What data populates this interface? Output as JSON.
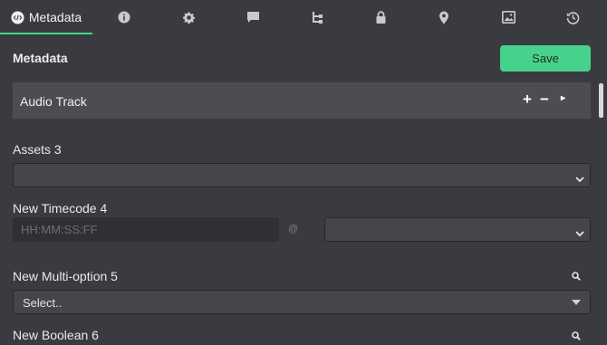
{
  "tabs": [
    {
      "label": "Metadata",
      "icon": "code-icon"
    },
    {
      "icon": "info-icon"
    },
    {
      "icon": "gear-icon"
    },
    {
      "icon": "comment-icon"
    },
    {
      "icon": "tree-icon"
    },
    {
      "icon": "lock-icon"
    },
    {
      "icon": "map-pin-icon"
    },
    {
      "icon": "image-icon"
    },
    {
      "icon": "history-icon"
    }
  ],
  "header": {
    "title": "Metadata",
    "save_label": "Save"
  },
  "audio_track": {
    "label": "Audio Track",
    "add": "+",
    "remove": "−",
    "expand": "▸"
  },
  "fields": {
    "assets": {
      "label": "Assets 3",
      "value": ""
    },
    "timecode": {
      "label": "New Timecode 4",
      "placeholder": "HH:MM:SS:FF",
      "at": "@",
      "rate_value": ""
    },
    "multi": {
      "label": "New Multi-option 5",
      "value": "Select.."
    },
    "boolean": {
      "label": "New Boolean 6"
    }
  },
  "colors": {
    "accent": "#42d487",
    "save_bg": "#46d28c",
    "background": "#3a3b40"
  }
}
